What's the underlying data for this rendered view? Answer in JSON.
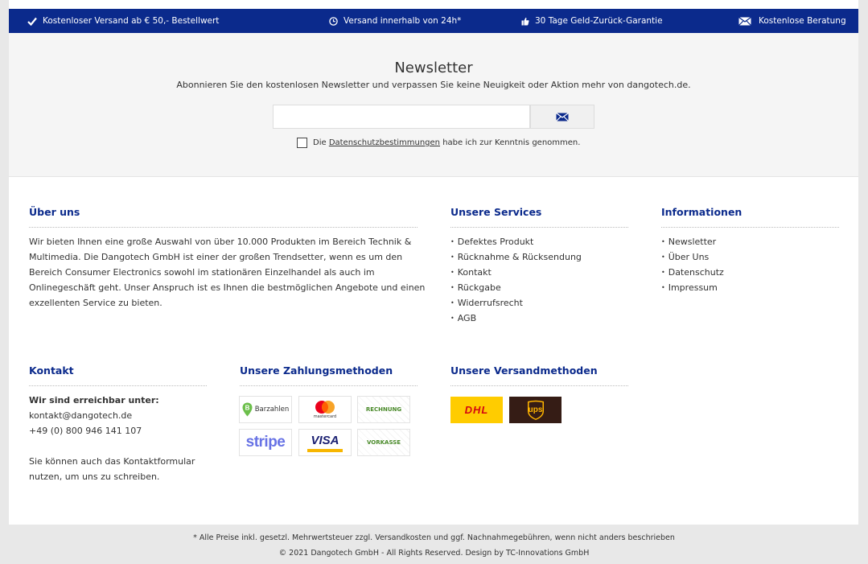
{
  "usp": {
    "shipping": "Kostenloser Versand ab € 50,- Bestellwert",
    "delivery": "Versand innerhalb von 24h*",
    "guarantee": "30 Tage Geld-Zurück-Garantie",
    "advice": "Kostenlose Beratung"
  },
  "newsletter": {
    "title": "Newsletter",
    "subtitle": "Abonnieren Sie den kostenlosen Newsletter und verpassen Sie keine Neuigkeit oder Aktion mehr von dangotech.de.",
    "email_value": "",
    "privacy_prefix": "Die ",
    "privacy_link": "Datenschutzbestimmungen",
    "privacy_suffix": " habe ich zur Kenntnis genommen."
  },
  "about": {
    "title": "Über uns",
    "text": "Wir bieten Ihnen eine große Auswahl von über 10.000 Produkten im Bereich Technik & Multimedia. Die Dangotech GmbH ist einer der großen Trendsetter, wenn es um den Bereich Consumer Electronics sowohl im stationären Einzelhandel als auch im Onlinegeschäft geht. Unser Anspruch ist es Ihnen die bestmöglichen Angebote und einen exzellenten Service zu bieten."
  },
  "services": {
    "title": "Unsere Services",
    "items": [
      "Defektes Produkt",
      "Rücknahme & Rücksendung",
      "Kontakt",
      "Rückgabe",
      "Widerrufsrecht",
      "AGB"
    ]
  },
  "info": {
    "title": "Informationen",
    "items": [
      "Newsletter",
      "Über Uns",
      "Datenschutz",
      "Impressum"
    ]
  },
  "contact": {
    "title": "Kontakt",
    "reachable": "Wir sind erreichbar unter:",
    "email": "kontakt@dangotech.de",
    "phone": "+49 (0) 800 946 141 107",
    "form_note": "Sie können auch das Kontaktformular nutzen, um uns zu schreiben."
  },
  "payment": {
    "title": "Unsere Zahlungsmethoden",
    "methods": {
      "barzahlen": "Barzahlen",
      "mastercard": "mastercard",
      "rechnung": "RECHNUNG",
      "stripe": "stripe",
      "visa": "VISA",
      "vorkasse": "VORKASSE"
    }
  },
  "shipping": {
    "title": "Unsere Versandmethoden",
    "dhl": "DHL",
    "ups": "ups"
  },
  "footer": {
    "tax_note": "* Alle Preise inkl. gesetzl. Mehrwertsteuer zzgl. Versandkosten und ggf. Nachnahmegebühren, wenn nicht anders beschrieben",
    "copyright": "© 2021 Dangotech GmbH - All Rights Reserved. Design by TC-Innovations GmbH"
  },
  "colors": {
    "brand_blue": "#0b2a8c",
    "dhl_yellow": "#ffcc00",
    "dhl_red": "#d40511",
    "ups_brown": "#351c15",
    "ups_gold": "#ffb500",
    "stripe_purple": "#6772e5",
    "visa_blue": "#1a1f71"
  }
}
